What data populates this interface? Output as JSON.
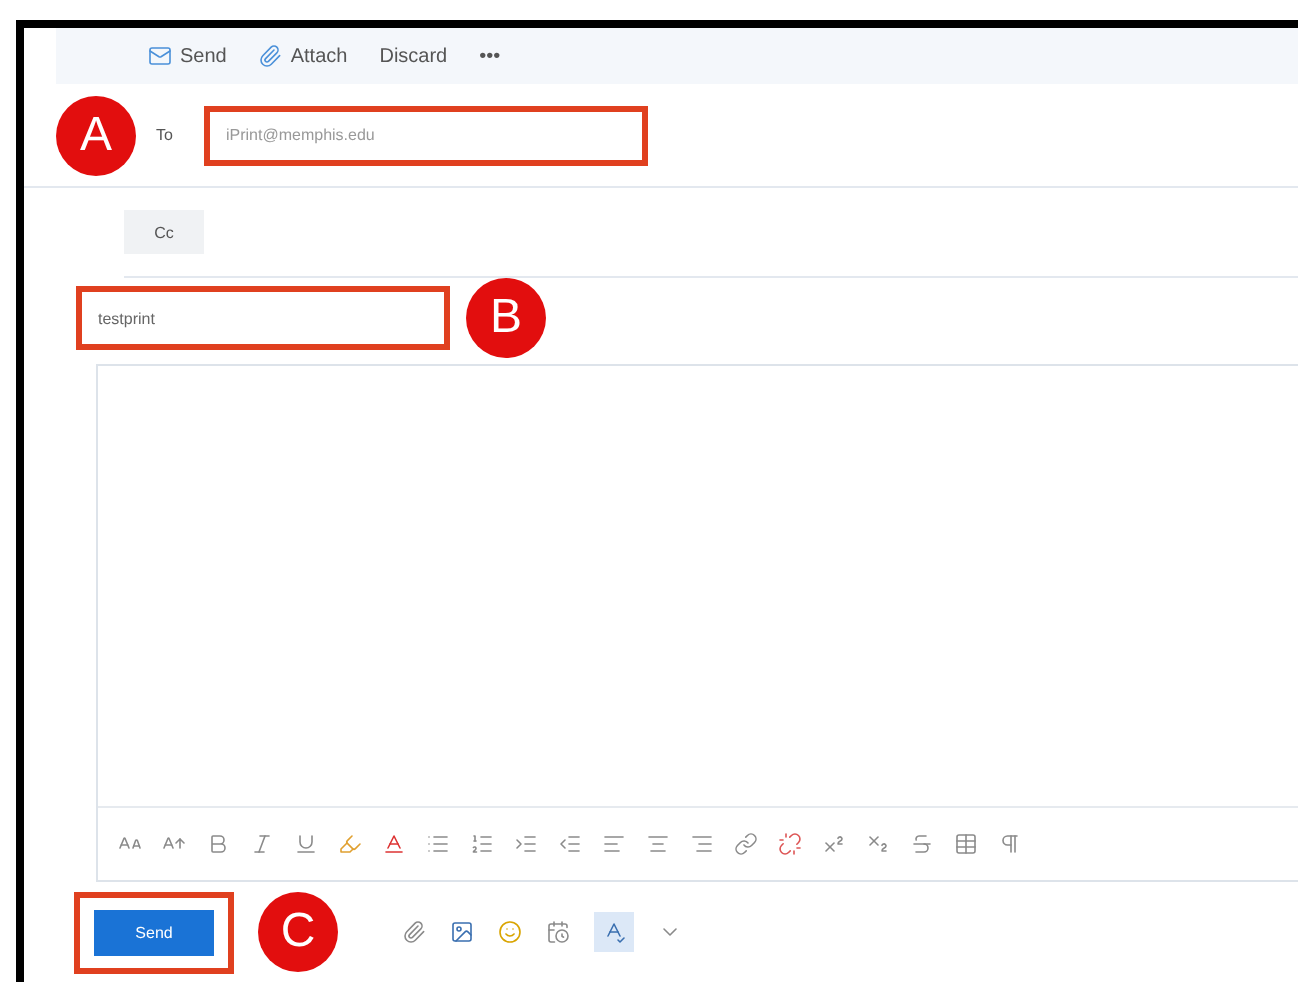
{
  "toolbar": [
    {
      "kind": "send",
      "label": "Send"
    },
    {
      "kind": "attach",
      "label": "Attach"
    },
    {
      "kind": "text",
      "label": "Discard"
    },
    {
      "kind": "text",
      "label": "•••"
    }
  ],
  "to": {
    "label": "To",
    "placeholder": "iPrint@memphis.edu",
    "marker": "A"
  },
  "cc": {
    "label": "Cc"
  },
  "subject": {
    "value": "testprint",
    "marker": "B"
  },
  "send_button": {
    "label": "Send",
    "marker": "C"
  }
}
